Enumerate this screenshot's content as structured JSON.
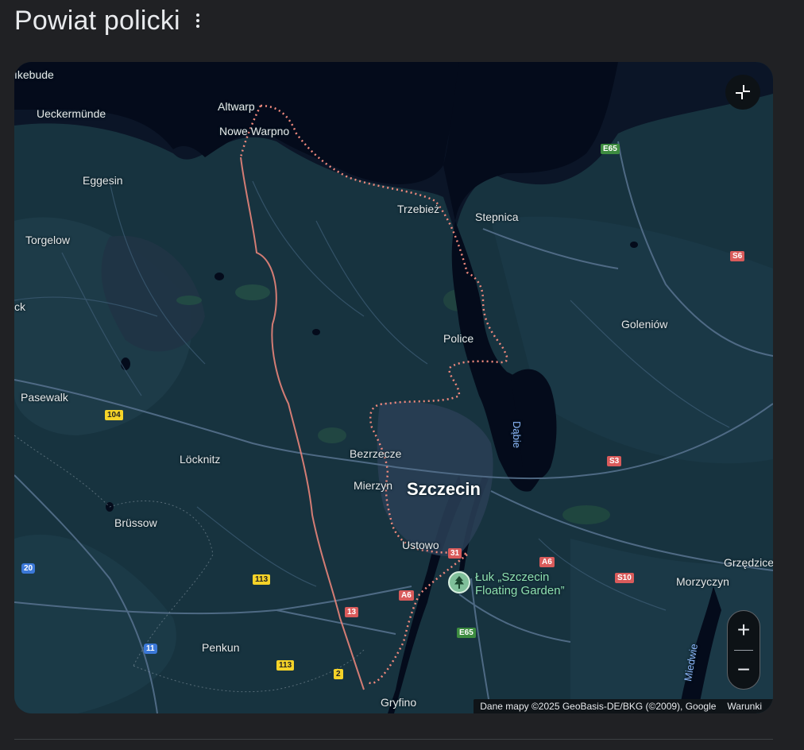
{
  "header": {
    "title": "Powiat policki"
  },
  "map": {
    "labels": {
      "ukkebude": "ıkebude",
      "ueckermunde": "Ueckermünde",
      "altwarp": "Altwarp",
      "nowe_warpno": "Nowe Warpno",
      "eggesin": "Eggesin",
      "torgelow": "Torgelow",
      "trzebiez": "Trzebież",
      "stepnica": "Stepnica",
      "goleniow": "Goleniów",
      "ck": "ck",
      "police": "Police",
      "pasewalk": "Pasewalk",
      "locknitz": "Löcknitz",
      "bezrzecze": "Bezrzecze",
      "mierzyn": "Mierzyn",
      "szczecin": "Szczecin",
      "brussow": "Brüssow",
      "ustowo": "Ustowo",
      "grzedzice": "Grzędzice",
      "morzyczyn": "Morzyczyn",
      "penkun": "Penkun",
      "gryfino": "Gryfino",
      "dabie": "Dąbie",
      "miedwie": "Miedwie",
      "poi": "Łuk „Szczecin\nFloating Garden”"
    },
    "shields": {
      "e65_top": "E65",
      "s6": "S6",
      "r104": "104",
      "s3": "S3",
      "r31": "31",
      "a6_right": "A6",
      "s10": "S10",
      "a6_left": "A6",
      "r20": "20",
      "r113_top": "113",
      "r13": "13",
      "e65_bottom": "E65",
      "r11": "11",
      "r113_bottom": "113",
      "r2": "2"
    },
    "attribution": "Dane mapy ©2025 GeoBasis-DE/BKG (©2009), Google",
    "terms": "Warunki",
    "controls": {
      "zoom_in": "+",
      "zoom_out": "−"
    }
  }
}
